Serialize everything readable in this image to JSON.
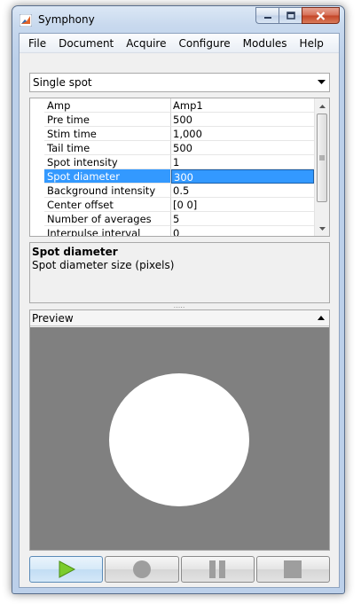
{
  "window": {
    "title": "Symphony"
  },
  "menu": [
    "File",
    "Document",
    "Acquire",
    "Configure",
    "Modules",
    "Help"
  ],
  "protocol_select": {
    "selected": "Single spot"
  },
  "properties": [
    {
      "name": "Amp",
      "value": "Amp1"
    },
    {
      "name": "Pre time",
      "value": "500"
    },
    {
      "name": "Stim time",
      "value": "1,000"
    },
    {
      "name": "Tail time",
      "value": "500"
    },
    {
      "name": "Spot intensity",
      "value": "1"
    },
    {
      "name": "Spot diameter",
      "value": "300",
      "selected": true
    },
    {
      "name": "Background intensity",
      "value": "0.5"
    },
    {
      "name": "Center offset",
      "value": "[0 0]"
    },
    {
      "name": "Number of averages",
      "value": "5"
    },
    {
      "name": "Interpulse interval",
      "value": "0"
    }
  ],
  "description": {
    "title": "Spot diameter",
    "body": "Spot diameter size (pixels)"
  },
  "preview": {
    "title": "Preview",
    "background_color": "#808080",
    "spot_color": "#ffffff"
  },
  "controls": [
    {
      "name": "play-button",
      "icon": "play-icon",
      "active": true
    },
    {
      "name": "record-button",
      "icon": "record-icon",
      "active": false
    },
    {
      "name": "pause-button",
      "icon": "pause-icon",
      "active": false
    },
    {
      "name": "stop-button",
      "icon": "stop-icon",
      "active": false
    }
  ],
  "colors": {
    "selection": "#3399ff",
    "play_icon": "#7ccc2e"
  }
}
